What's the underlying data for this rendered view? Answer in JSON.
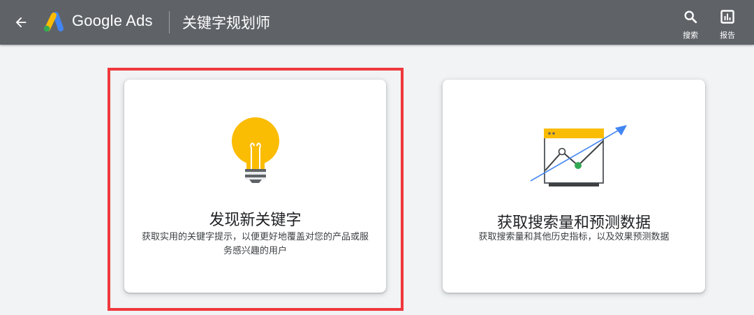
{
  "app": {
    "brand": "Google Ads",
    "page_title": "关键字规划师"
  },
  "header": {
    "back_icon": "arrow-back-icon",
    "tools": [
      {
        "label": "搜索",
        "icon": "search-icon"
      },
      {
        "label": "报告",
        "icon": "bar-chart-icon"
      }
    ]
  },
  "cards": [
    {
      "title": "发现新关键字",
      "description": "获取实用的关键字提示，以便更好地覆盖对您的产品或服务感兴趣的用户",
      "icon": "lightbulb-icon"
    },
    {
      "title": "获取搜索量和预测数据",
      "description": "获取搜索量和其他历史指标，以及效果预测数据",
      "icon": "trend-chart-icon"
    }
  ],
  "colors": {
    "topbar": "#5f6368",
    "background": "#f1f3f4",
    "highlight": "#f0383c",
    "bulb": "#fbbc04",
    "arrow": "#4285f4",
    "point": "#34a853"
  }
}
